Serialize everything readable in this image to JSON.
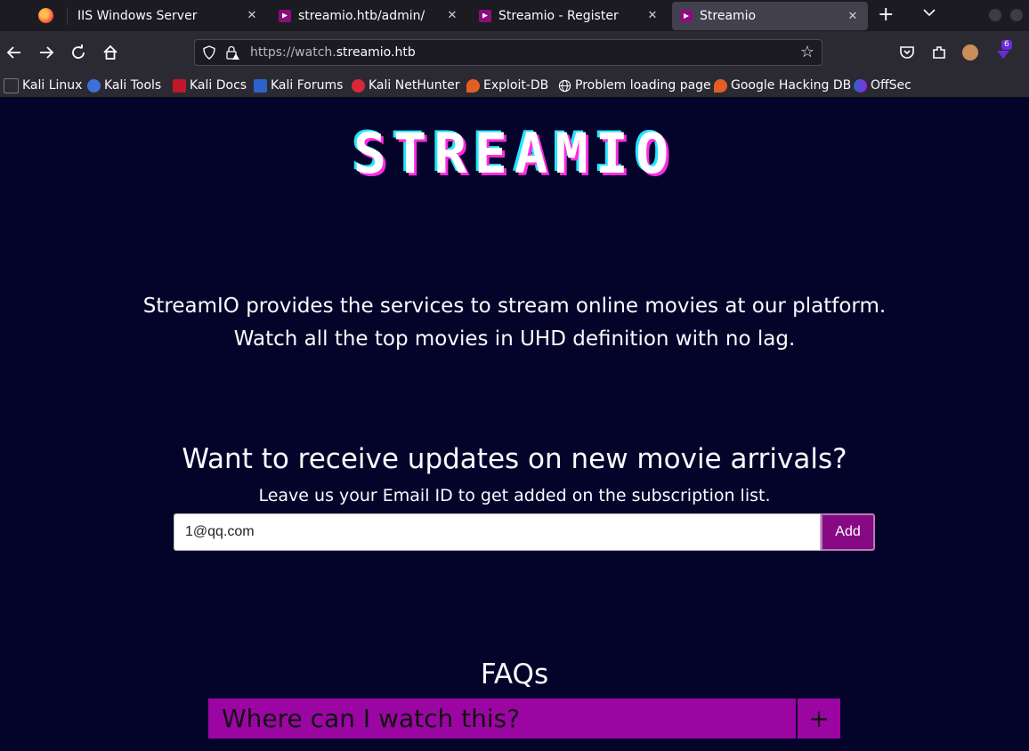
{
  "tabs": [
    {
      "label": "IIS Windows Server"
    },
    {
      "label": "streamio.htb/admin/"
    },
    {
      "label": "Streamio - Register"
    },
    {
      "label": "Streamio"
    }
  ],
  "url": {
    "prefix": "https://watch.",
    "domain": "streamio.htb"
  },
  "extension_badge": "6",
  "bookmarks": [
    {
      "label": "Kali Linux"
    },
    {
      "label": "Kali Tools"
    },
    {
      "label": "Kali Docs"
    },
    {
      "label": "Kali Forums"
    },
    {
      "label": "Kali NetHunter"
    },
    {
      "label": "Exploit-DB"
    },
    {
      "label": "Problem loading page"
    },
    {
      "label": "Google Hacking DB"
    },
    {
      "label": "OffSec"
    }
  ],
  "page": {
    "logo": "STREAMIO",
    "intro_line1": "StreamIO provides the services to stream online movies at our platform.",
    "intro_line2": "Watch all the top movies in UHD definition with no lag.",
    "subscribe_title": "Want to receive updates on new movie arrivals?",
    "subscribe_desc": "Leave us your Email ID to get added on the subscription list.",
    "email_value": "1@qq.com",
    "add_label": "Add",
    "faq_title": "FAQs",
    "faq_question": "Where can I watch this?",
    "faq_toggle": "+"
  },
  "colors": {
    "page_bg": "#04042b",
    "accent": "#9b06a3",
    "button": "#870a84"
  }
}
